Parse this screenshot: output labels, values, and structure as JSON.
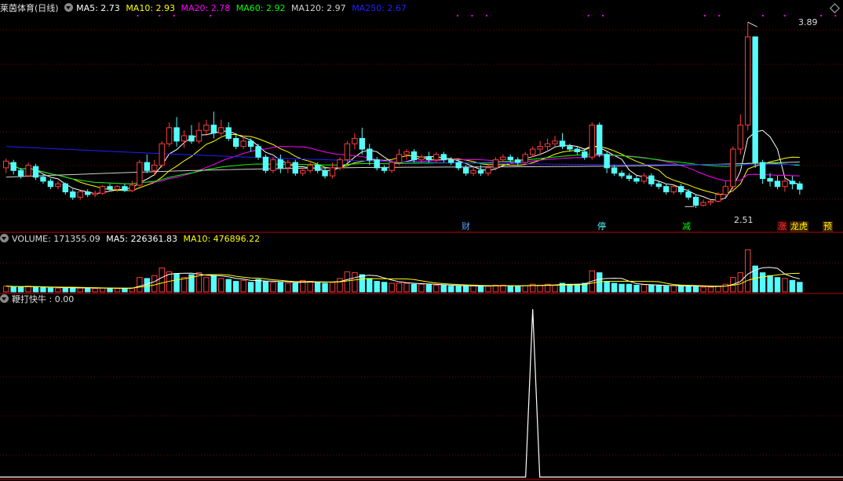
{
  "price_header": {
    "stock_name": "莱茵体育(日线)",
    "ma5": "MA5: 2.73",
    "ma10": "MA10: 2.93",
    "ma20": "MA20: 2.78",
    "ma60": "MA60: 2.92",
    "ma120": "MA120: 2.97",
    "ma250": "MA250: 2.67"
  },
  "volume_header": {
    "volume": "VOLUME: 171355.09",
    "ma5": "MA5: 226361.83",
    "ma10": "MA10: 476896.22"
  },
  "indicator_header": {
    "name": "鞭打快牛 : 0.00"
  },
  "annotations": {
    "high": "3.89",
    "low": "2.51"
  },
  "event_tags": [
    "财",
    "停",
    "减",
    "涨",
    "龙虎",
    "预"
  ],
  "colors": {
    "up": "#ff3c3c",
    "down": "#54fcfc",
    "ma5": "#ffffff",
    "ma10": "#ffff00",
    "ma20": "#ff00ff",
    "ma60": "#00ff00",
    "ma120": "#d0d0d0",
    "ma250": "#2020ff",
    "grid": "#800000"
  },
  "chart_data": {
    "type": "candlestick",
    "price_range": [
      2.4,
      3.95
    ],
    "candles": [
      [
        2.8,
        2.85,
        2.76,
        2.87
      ],
      [
        2.84,
        2.78,
        2.75,
        2.86
      ],
      [
        2.78,
        2.74,
        2.72,
        2.8
      ],
      [
        2.74,
        2.82,
        2.73,
        2.84
      ],
      [
        2.81,
        2.73,
        2.71,
        2.83
      ],
      [
        2.73,
        2.7,
        2.68,
        2.75
      ],
      [
        2.7,
        2.66,
        2.64,
        2.72
      ],
      [
        2.66,
        2.68,
        2.64,
        2.7
      ],
      [
        2.68,
        2.62,
        2.6,
        2.69
      ],
      [
        2.62,
        2.58,
        2.56,
        2.64
      ],
      [
        2.58,
        2.62,
        2.56,
        2.63
      ],
      [
        2.62,
        2.6,
        2.58,
        2.64
      ],
      [
        2.6,
        2.61,
        2.58,
        2.63
      ],
      [
        2.61,
        2.66,
        2.6,
        2.67
      ],
      [
        2.66,
        2.64,
        2.63,
        2.68
      ],
      [
        2.64,
        2.66,
        2.62,
        2.67
      ],
      [
        2.66,
        2.63,
        2.62,
        2.68
      ],
      [
        2.63,
        2.67,
        2.62,
        2.7
      ],
      [
        2.67,
        2.84,
        2.66,
        2.86
      ],
      [
        2.84,
        2.78,
        2.76,
        2.9
      ],
      [
        2.78,
        2.82,
        2.74,
        2.86
      ],
      [
        2.82,
        2.98,
        2.8,
        3.0
      ],
      [
        2.98,
        3.1,
        2.96,
        3.14
      ],
      [
        3.1,
        3.0,
        2.96,
        3.18
      ],
      [
        3.0,
        3.04,
        2.95,
        3.08
      ],
      [
        3.04,
        3.0,
        2.98,
        3.12
      ],
      [
        3.0,
        3.08,
        2.98,
        3.14
      ],
      [
        3.08,
        3.12,
        3.04,
        3.16
      ],
      [
        3.12,
        3.06,
        3.02,
        3.22
      ],
      [
        3.06,
        3.1,
        3.04,
        3.16
      ],
      [
        3.1,
        3.02,
        3.0,
        3.14
      ],
      [
        3.02,
        2.96,
        2.94,
        3.06
      ],
      [
        2.96,
        3.0,
        2.94,
        3.04
      ],
      [
        3.0,
        2.96,
        2.92,
        3.02
      ],
      [
        2.96,
        2.88,
        2.86,
        2.98
      ],
      [
        2.88,
        2.78,
        2.76,
        2.9
      ],
      [
        2.78,
        2.86,
        2.76,
        2.88
      ],
      [
        2.86,
        2.8,
        2.76,
        2.9
      ],
      [
        2.8,
        2.84,
        2.76,
        2.86
      ],
      [
        2.84,
        2.76,
        2.74,
        2.86
      ],
      [
        2.76,
        2.78,
        2.74,
        2.8
      ],
      [
        2.78,
        2.82,
        2.76,
        2.84
      ],
      [
        2.82,
        2.78,
        2.76,
        2.84
      ],
      [
        2.78,
        2.74,
        2.72,
        2.8
      ],
      [
        2.74,
        2.8,
        2.72,
        2.84
      ],
      [
        2.8,
        2.86,
        2.78,
        2.88
      ],
      [
        2.86,
        2.98,
        2.84,
        3.0
      ],
      [
        2.98,
        3.02,
        2.94,
        3.06
      ],
      [
        3.02,
        2.94,
        2.9,
        3.1
      ],
      [
        2.94,
        2.86,
        2.82,
        2.98
      ],
      [
        2.86,
        2.8,
        2.78,
        2.88
      ],
      [
        2.8,
        2.78,
        2.76,
        2.82
      ],
      [
        2.78,
        2.84,
        2.76,
        2.86
      ],
      [
        2.84,
        2.9,
        2.82,
        2.94
      ],
      [
        2.9,
        2.92,
        2.86,
        2.94
      ],
      [
        2.92,
        2.86,
        2.84,
        2.94
      ],
      [
        2.86,
        2.88,
        2.84,
        2.9
      ],
      [
        2.88,
        2.86,
        2.84,
        2.92
      ],
      [
        2.86,
        2.9,
        2.84,
        2.92
      ],
      [
        2.9,
        2.86,
        2.84,
        2.92
      ],
      [
        2.86,
        2.84,
        2.82,
        2.88
      ],
      [
        2.84,
        2.8,
        2.78,
        2.86
      ],
      [
        2.8,
        2.76,
        2.74,
        2.82
      ],
      [
        2.76,
        2.78,
        2.74,
        2.8
      ],
      [
        2.78,
        2.76,
        2.74,
        2.82
      ],
      [
        2.76,
        2.8,
        2.74,
        2.82
      ],
      [
        2.8,
        2.86,
        2.78,
        2.88
      ],
      [
        2.86,
        2.88,
        2.84,
        2.9
      ],
      [
        2.88,
        2.86,
        2.84,
        2.9
      ],
      [
        2.86,
        2.84,
        2.82,
        2.88
      ],
      [
        2.84,
        2.9,
        2.82,
        2.92
      ],
      [
        2.9,
        2.94,
        2.88,
        2.96
      ],
      [
        2.94,
        2.96,
        2.9,
        3.0
      ],
      [
        2.96,
        2.98,
        2.92,
        3.02
      ],
      [
        2.98,
        3.0,
        2.96,
        3.04
      ],
      [
        3.0,
        2.96,
        2.94,
        3.06
      ],
      [
        2.96,
        2.94,
        2.92,
        2.98
      ],
      [
        2.94,
        2.92,
        2.9,
        2.96
      ],
      [
        2.92,
        2.88,
        2.86,
        2.94
      ],
      [
        2.88,
        3.12,
        2.86,
        3.14
      ],
      [
        3.12,
        2.9,
        2.88,
        3.14
      ],
      [
        2.9,
        2.8,
        2.76,
        2.92
      ],
      [
        2.8,
        2.76,
        2.74,
        2.82
      ],
      [
        2.76,
        2.74,
        2.72,
        2.78
      ],
      [
        2.74,
        2.72,
        2.7,
        2.76
      ],
      [
        2.72,
        2.7,
        2.68,
        2.74
      ],
      [
        2.7,
        2.74,
        2.68,
        2.76
      ],
      [
        2.74,
        2.68,
        2.66,
        2.76
      ],
      [
        2.68,
        2.66,
        2.64,
        2.7
      ],
      [
        2.66,
        2.62,
        2.6,
        2.68
      ],
      [
        2.62,
        2.66,
        2.6,
        2.68
      ],
      [
        2.66,
        2.62,
        2.6,
        2.68
      ],
      [
        2.62,
        2.58,
        2.56,
        2.64
      ],
      [
        2.58,
        2.52,
        2.5,
        2.6
      ],
      [
        2.52,
        2.54,
        2.51,
        2.56
      ],
      [
        2.54,
        2.55,
        2.52,
        2.56
      ],
      [
        2.55,
        2.6,
        2.54,
        2.62
      ],
      [
        2.6,
        2.66,
        2.58,
        2.7
      ],
      [
        2.66,
        2.94,
        2.64,
        2.96
      ],
      [
        2.94,
        3.12,
        2.9,
        3.2
      ],
      [
        3.12,
        3.78,
        3.08,
        3.89
      ],
      [
        3.78,
        2.84,
        2.8,
        3.3
      ],
      [
        2.84,
        2.72,
        2.68,
        2.86
      ],
      [
        2.72,
        2.7,
        2.66,
        2.76
      ],
      [
        2.7,
        2.66,
        2.64,
        2.74
      ],
      [
        2.66,
        2.7,
        2.62,
        2.72
      ],
      [
        2.7,
        2.68,
        2.64,
        2.74
      ],
      [
        2.68,
        2.64,
        2.6,
        2.7
      ]
    ],
    "volume": [
      12,
      11,
      10,
      12,
      10,
      9,
      8,
      8,
      9,
      9,
      8,
      8,
      7,
      8,
      8,
      7,
      7,
      8,
      30,
      28,
      34,
      50,
      42,
      38,
      30,
      36,
      40,
      30,
      34,
      28,
      26,
      22,
      24,
      20,
      26,
      22,
      20,
      20,
      18,
      18,
      24,
      22,
      20,
      18,
      20,
      28,
      42,
      40,
      36,
      28,
      22,
      20,
      18,
      18,
      18,
      16,
      16,
      15,
      14,
      14,
      12,
      12,
      12,
      13,
      12,
      12,
      14,
      14,
      13,
      12,
      13,
      16,
      14,
      16,
      14,
      18,
      16,
      16,
      18,
      44,
      40,
      22,
      18,
      16,
      16,
      14,
      15,
      14,
      13,
      12,
      13,
      12,
      12,
      12,
      10,
      10,
      12,
      16,
      30,
      40,
      88,
      54,
      40,
      34,
      30,
      28,
      24,
      20
    ],
    "volume_range": [
      0,
      95
    ],
    "indicator": {
      "peak_index": 71,
      "peak_value": 1,
      "range": [
        0,
        1
      ]
    }
  }
}
